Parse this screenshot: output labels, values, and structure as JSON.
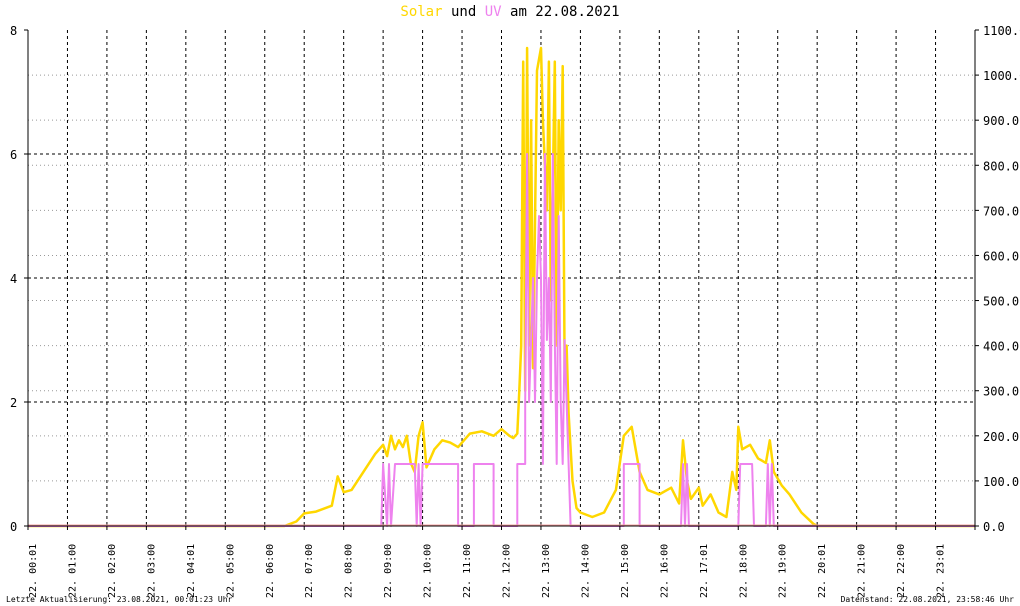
{
  "header": {
    "title_solar": "Solar",
    "title_und": "und",
    "title_uv": "UV",
    "title_date": "am 22.08.2021"
  },
  "footer": {
    "left": "Letzte Aktualisierung: 23.08.2021, 00:01:23 Uhr",
    "right": "Datenstand: 22.08.2021, 23:58:46 Uhr"
  },
  "colors": {
    "solar": "#ffd700",
    "uv": "#ee82ee",
    "axis": "#000000",
    "grid": "#000000"
  },
  "chart_data": {
    "type": "line",
    "title": "Solar und UV am 22.08.2021",
    "grid": true,
    "y_left": {
      "min": 0,
      "max": 8,
      "ticks": [
        "0",
        "2",
        "4",
        "6",
        "8"
      ]
    },
    "y_right": {
      "min": 0,
      "max": 1100,
      "ticks": [
        "0.0",
        "100.0",
        "200.0",
        "300.0",
        "400.0",
        "500.0",
        "600.0",
        "700.0",
        "800.0",
        "900.0",
        "1000.0",
        "1100.0"
      ]
    },
    "x_ticks": [
      "22. 00:01",
      "22. 01:00",
      "22. 02:00",
      "22. 03:00",
      "22. 04:01",
      "22. 05:00",
      "22. 06:00",
      "22. 07:00",
      "22. 08:00",
      "22. 09:00",
      "22. 10:00",
      "22. 11:00",
      "22. 12:00",
      "22. 13:00",
      "22. 14:00",
      "22. 15:00",
      "22. 16:00",
      "22. 17:01",
      "22. 18:00",
      "22. 19:00",
      "22. 20:01",
      "22. 21:00",
      "22. 22:00",
      "22. 23:01"
    ],
    "series": [
      {
        "name": "Solar",
        "axis": "right",
        "x_hours": [
          0,
          6.5,
          6.8,
          7.0,
          7.3,
          7.7,
          7.85,
          8.0,
          8.2,
          8.5,
          8.8,
          9.0,
          9.1,
          9.2,
          9.3,
          9.4,
          9.5,
          9.6,
          9.7,
          9.8,
          9.9,
          10.0,
          10.1,
          10.3,
          10.5,
          10.7,
          10.9,
          11.2,
          11.5,
          11.8,
          12.0,
          12.2,
          12.3,
          12.4,
          12.45,
          12.5,
          12.55,
          12.6,
          12.65,
          12.7,
          12.75,
          12.8,
          12.9,
          13.0,
          13.05,
          13.1,
          13.15,
          13.2,
          13.25,
          13.3,
          13.35,
          13.4,
          13.45,
          13.5,
          13.55,
          13.6,
          13.65,
          13.7,
          13.8,
          13.9,
          14.0,
          14.3,
          14.6,
          14.9,
          15.1,
          15.3,
          15.5,
          15.7,
          16.0,
          16.3,
          16.5,
          16.6,
          16.7,
          16.8,
          17.0,
          17.1,
          17.3,
          17.5,
          17.7,
          17.85,
          17.95,
          18.0,
          18.1,
          18.3,
          18.5,
          18.7,
          18.8,
          18.9,
          19.1,
          19.3,
          19.6,
          19.9,
          20.0,
          20.3,
          24.0
        ],
        "values": [
          0,
          0,
          10,
          28,
          32,
          45,
          110,
          75,
          80,
          120,
          160,
          180,
          155,
          200,
          170,
          190,
          175,
          200,
          140,
          120,
          200,
          230,
          130,
          170,
          190,
          185,
          175,
          205,
          210,
          200,
          215,
          200,
          195,
          205,
          300,
          400,
          1030,
          300,
          1060,
          400,
          900,
          350,
          1010,
          1060,
          900,
          800,
          700,
          1030,
          500,
          750,
          1030,
          400,
          900,
          700,
          1020,
          350,
          400,
          250,
          100,
          40,
          30,
          20,
          30,
          80,
          200,
          220,
          120,
          80,
          70,
          85,
          50,
          190,
          100,
          60,
          85,
          45,
          70,
          30,
          20,
          120,
          80,
          220,
          170,
          180,
          150,
          140,
          190,
          120,
          90,
          70,
          30,
          5,
          0,
          0,
          0
        ]
      },
      {
        "name": "UV",
        "axis": "left",
        "x_hours": [
          0,
          8.95,
          9.0,
          9.1,
          9.15,
          9.2,
          9.3,
          9.35,
          9.8,
          9.85,
          9.9,
          9.95,
          10.0,
          10.05,
          10.1,
          10.9,
          10.9,
          11.3,
          11.3,
          11.8,
          11.8,
          12.4,
          12.4,
          12.6,
          12.6,
          12.65,
          12.7,
          12.75,
          12.8,
          12.85,
          12.9,
          12.95,
          13.0,
          13.05,
          13.1,
          13.15,
          13.2,
          13.25,
          13.3,
          13.35,
          13.4,
          13.45,
          13.5,
          13.55,
          13.6,
          13.65,
          13.7,
          13.75,
          13.8,
          15.1,
          15.1,
          15.5,
          15.5,
          16.55,
          16.6,
          16.65,
          16.7,
          16.75,
          16.8,
          18.0,
          18.05,
          18.1,
          18.35,
          18.4,
          18.7,
          18.75,
          18.8,
          18.85,
          18.9,
          24.0
        ],
        "values": [
          0,
          0,
          1,
          0,
          1,
          0,
          1,
          1,
          1,
          0,
          1,
          0,
          1,
          1,
          1,
          1,
          0,
          0,
          1,
          1,
          0,
          0,
          1,
          1,
          2,
          6,
          2,
          3,
          4,
          2,
          4,
          5,
          4,
          1,
          6,
          3,
          4,
          2,
          6,
          3,
          1,
          5,
          2,
          1,
          3,
          2,
          1,
          0,
          0,
          0,
          1,
          1,
          0,
          0,
          1,
          0,
          1,
          0,
          0,
          0,
          1,
          1,
          1,
          0,
          0,
          1,
          0,
          1,
          0,
          0
        ]
      }
    ]
  }
}
